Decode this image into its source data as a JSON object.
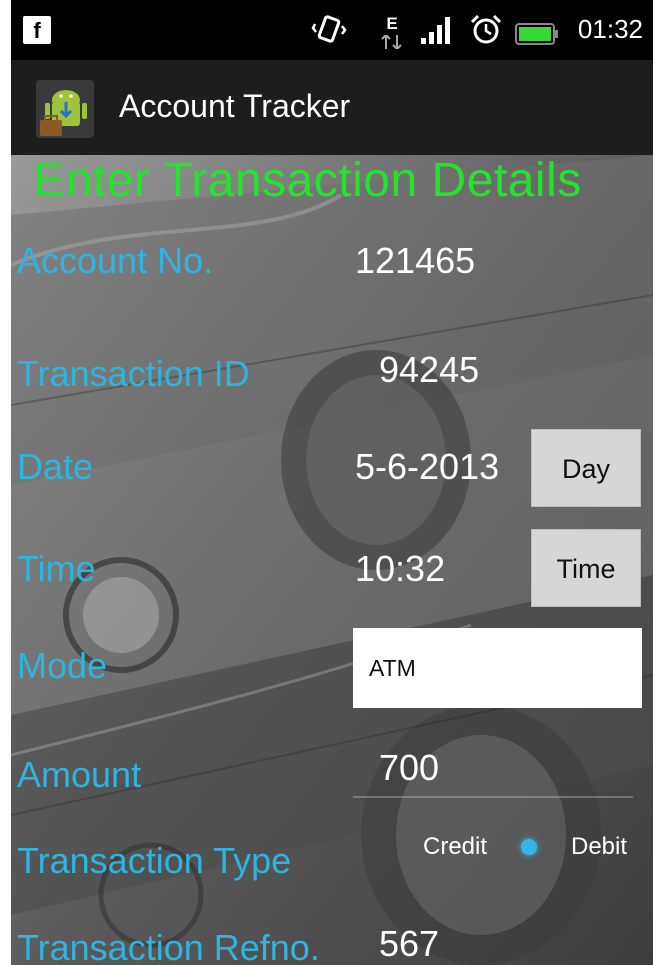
{
  "status_bar": {
    "fb_icon_glyph": "f",
    "time": "01:32",
    "icons": [
      "facebook-icon",
      "vibrate-icon",
      "edge-data-icon",
      "signal-icon",
      "alarm-icon",
      "battery-icon"
    ],
    "edge_label": "E"
  },
  "app": {
    "title": "Account Tracker",
    "icon": "android-app-icon"
  },
  "form": {
    "heading": "Enter Transaction Details",
    "account_no": {
      "label": "Account No.",
      "value": "121465"
    },
    "transaction_id": {
      "label": "Transaction ID",
      "value": "94245"
    },
    "date": {
      "label": "Date",
      "value": "5-6-2013",
      "button": "Day"
    },
    "time": {
      "label": "Time",
      "value": "10:32",
      "button": "Time"
    },
    "mode": {
      "label": "Mode",
      "value": "ATM"
    },
    "amount": {
      "label": "Amount",
      "value": "700"
    },
    "transaction_type": {
      "label": "Transaction Type",
      "options": [
        "Credit",
        "Debit"
      ],
      "selected": "Credit"
    },
    "transaction_refno": {
      "label": "Transaction Refno.",
      "value": "567"
    }
  },
  "colors": {
    "heading": "#22e52a",
    "label": "#2eb4e0",
    "radio_accent": "#33b5e5"
  }
}
